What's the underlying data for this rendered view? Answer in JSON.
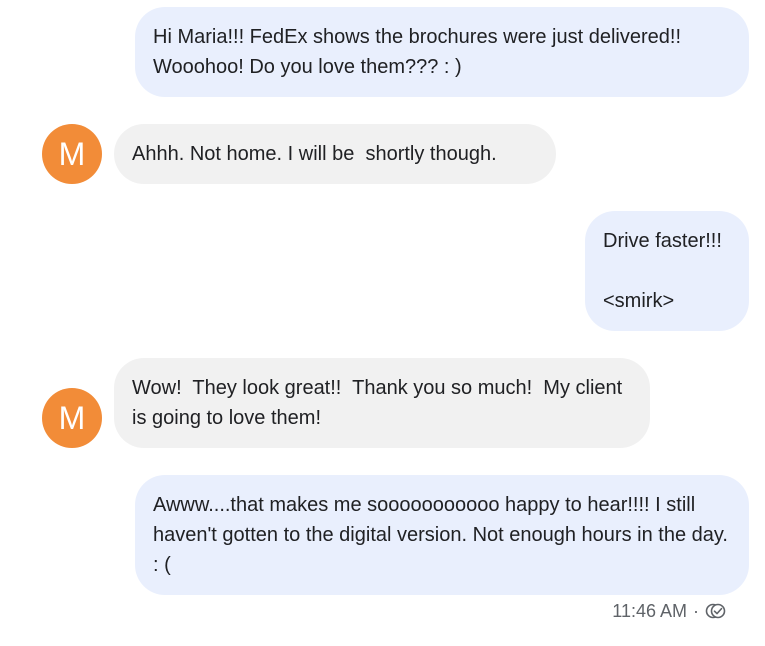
{
  "conversation": {
    "messages": [
      {
        "direction": "sent",
        "text": "Hi Maria!!! FedEx shows the brochures were just delivered!! Wooohoo! Do you love them??? : )"
      },
      {
        "direction": "received",
        "avatar_letter": "M",
        "text": "Ahhh. Not home. I will be  shortly though."
      },
      {
        "direction": "sent",
        "text": "Drive faster!!!\n\n<smirk>"
      },
      {
        "direction": "received",
        "avatar_letter": "M",
        "text": "Wow!  They look great!!  Thank you so much!  My client is going to love them!"
      },
      {
        "direction": "sent",
        "text": "Awww....that makes me sooooooooooo happy to hear!!!! I still haven't gotten to the digital version. Not enough hours in the day. : ("
      }
    ],
    "last_message_meta": {
      "time": "11:46 AM",
      "separator": "·",
      "status_icon": "read-receipt-icon"
    }
  },
  "colors": {
    "sent_bubble": "#e9effd",
    "received_bubble": "#f1f1f1",
    "avatar": "#f28c38",
    "meta_text": "#5f6368"
  }
}
